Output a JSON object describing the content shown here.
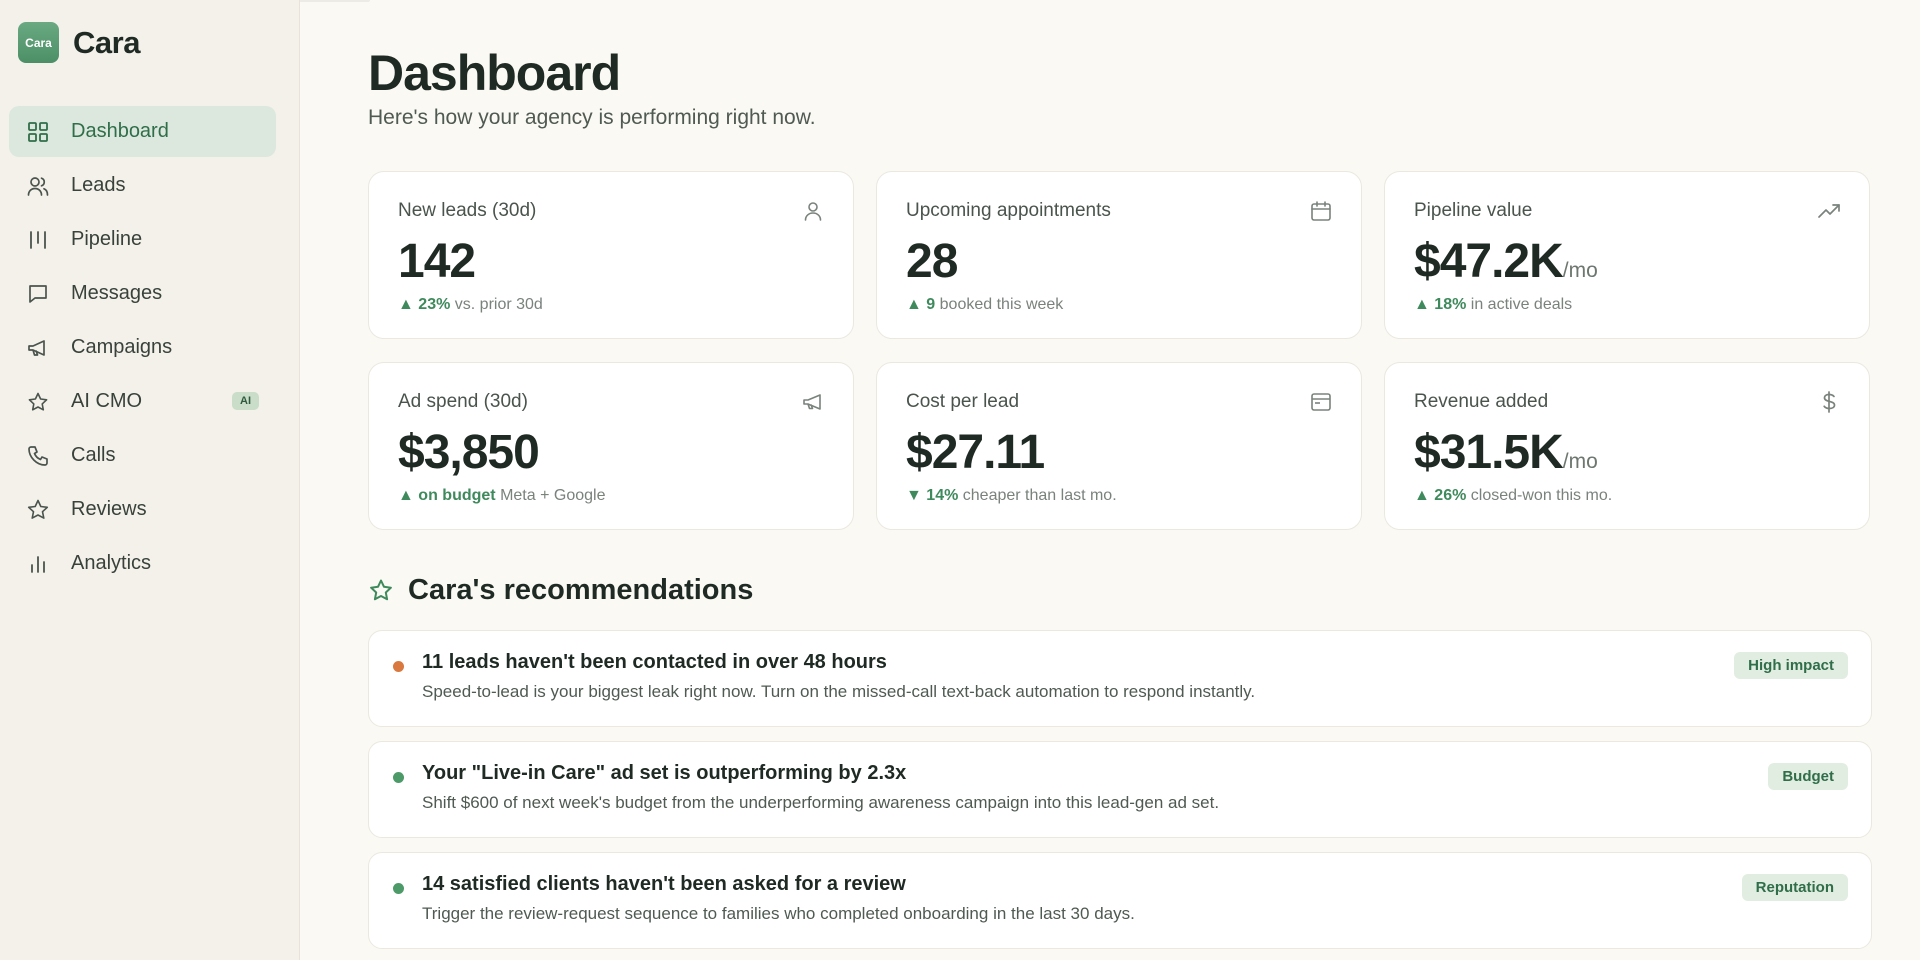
{
  "brand": {
    "logo_text": "Cara",
    "name": "Cara"
  },
  "nav": [
    {
      "label": "Dashboard",
      "icon": "grid-icon",
      "active": true
    },
    {
      "label": "Leads",
      "icon": "users-icon"
    },
    {
      "label": "Pipeline",
      "icon": "columns-icon"
    },
    {
      "label": "Messages",
      "icon": "message-icon"
    },
    {
      "label": "Campaigns",
      "icon": "megaphone-icon"
    },
    {
      "label": "AI CMO",
      "icon": "star-icon",
      "badge": "AI"
    },
    {
      "label": "Calls",
      "icon": "phone-icon"
    },
    {
      "label": "Reviews",
      "icon": "star-icon"
    },
    {
      "label": "Analytics",
      "icon": "bar-chart-icon"
    }
  ],
  "header": {
    "title": "Dashboard",
    "subtitle": "Here's how your agency is performing right now."
  },
  "stats": [
    {
      "label": "New leads (30d)",
      "icon": "user-icon",
      "value": "142",
      "unit": "",
      "trend_arrow": "▲",
      "trend": "23%",
      "note": "vs. prior 30d"
    },
    {
      "label": "Upcoming appointments",
      "icon": "calendar-icon",
      "value": "28",
      "unit": "",
      "trend_arrow": "▲",
      "trend": "9",
      "note": "booked this week"
    },
    {
      "label": "Pipeline value",
      "icon": "trending-up-icon",
      "value": "$47.2K",
      "unit": "/mo",
      "trend_arrow": "▲",
      "trend": "18%",
      "note": "in active deals"
    },
    {
      "label": "Ad spend (30d)",
      "icon": "megaphone-icon",
      "value": "$3,850",
      "unit": "",
      "trend_arrow": "▲",
      "trend": "on budget",
      "note": "Meta + Google"
    },
    {
      "label": "Cost per lead",
      "icon": "card-icon",
      "value": "$27.11",
      "unit": "",
      "trend_arrow": "▼",
      "trend": "14%",
      "note": "cheaper than last mo."
    },
    {
      "label": "Revenue added",
      "icon": "dollar-icon",
      "value": "$31.5K",
      "unit": "/mo",
      "trend_arrow": "▲",
      "trend": "26%",
      "note": "closed-won this mo."
    }
  ],
  "recommendations": {
    "title": "Cara's recommendations",
    "items": [
      {
        "title": "11 leads haven't been contacted in over 48 hours",
        "body": "Speed-to-lead is your biggest leak right now. Turn on the missed-call text-back automation to respond instantly.",
        "tag": "High impact",
        "dot_color": "#d9783f"
      },
      {
        "title": "Your \"Live-in Care\" ad set is outperforming by 2.3x",
        "body": "Shift $600 of next week's budget from the underperforming awareness campaign into this lead-gen ad set.",
        "tag": "Budget",
        "dot_color": "#4c9a68"
      },
      {
        "title": "14 satisfied clients haven't been asked for a review",
        "body": "Trigger the review-request sequence to families who completed onboarding in the last 30 days.",
        "tag": "Reputation",
        "dot_color": "#4c9a68"
      }
    ]
  },
  "colors": {
    "accent": "#2f6e49",
    "active_bg": "#dce8dd",
    "trend_green": "#3f8a5c",
    "sidebar_bg": "#f3f1ea",
    "page_bg": "#fbf9f4"
  }
}
